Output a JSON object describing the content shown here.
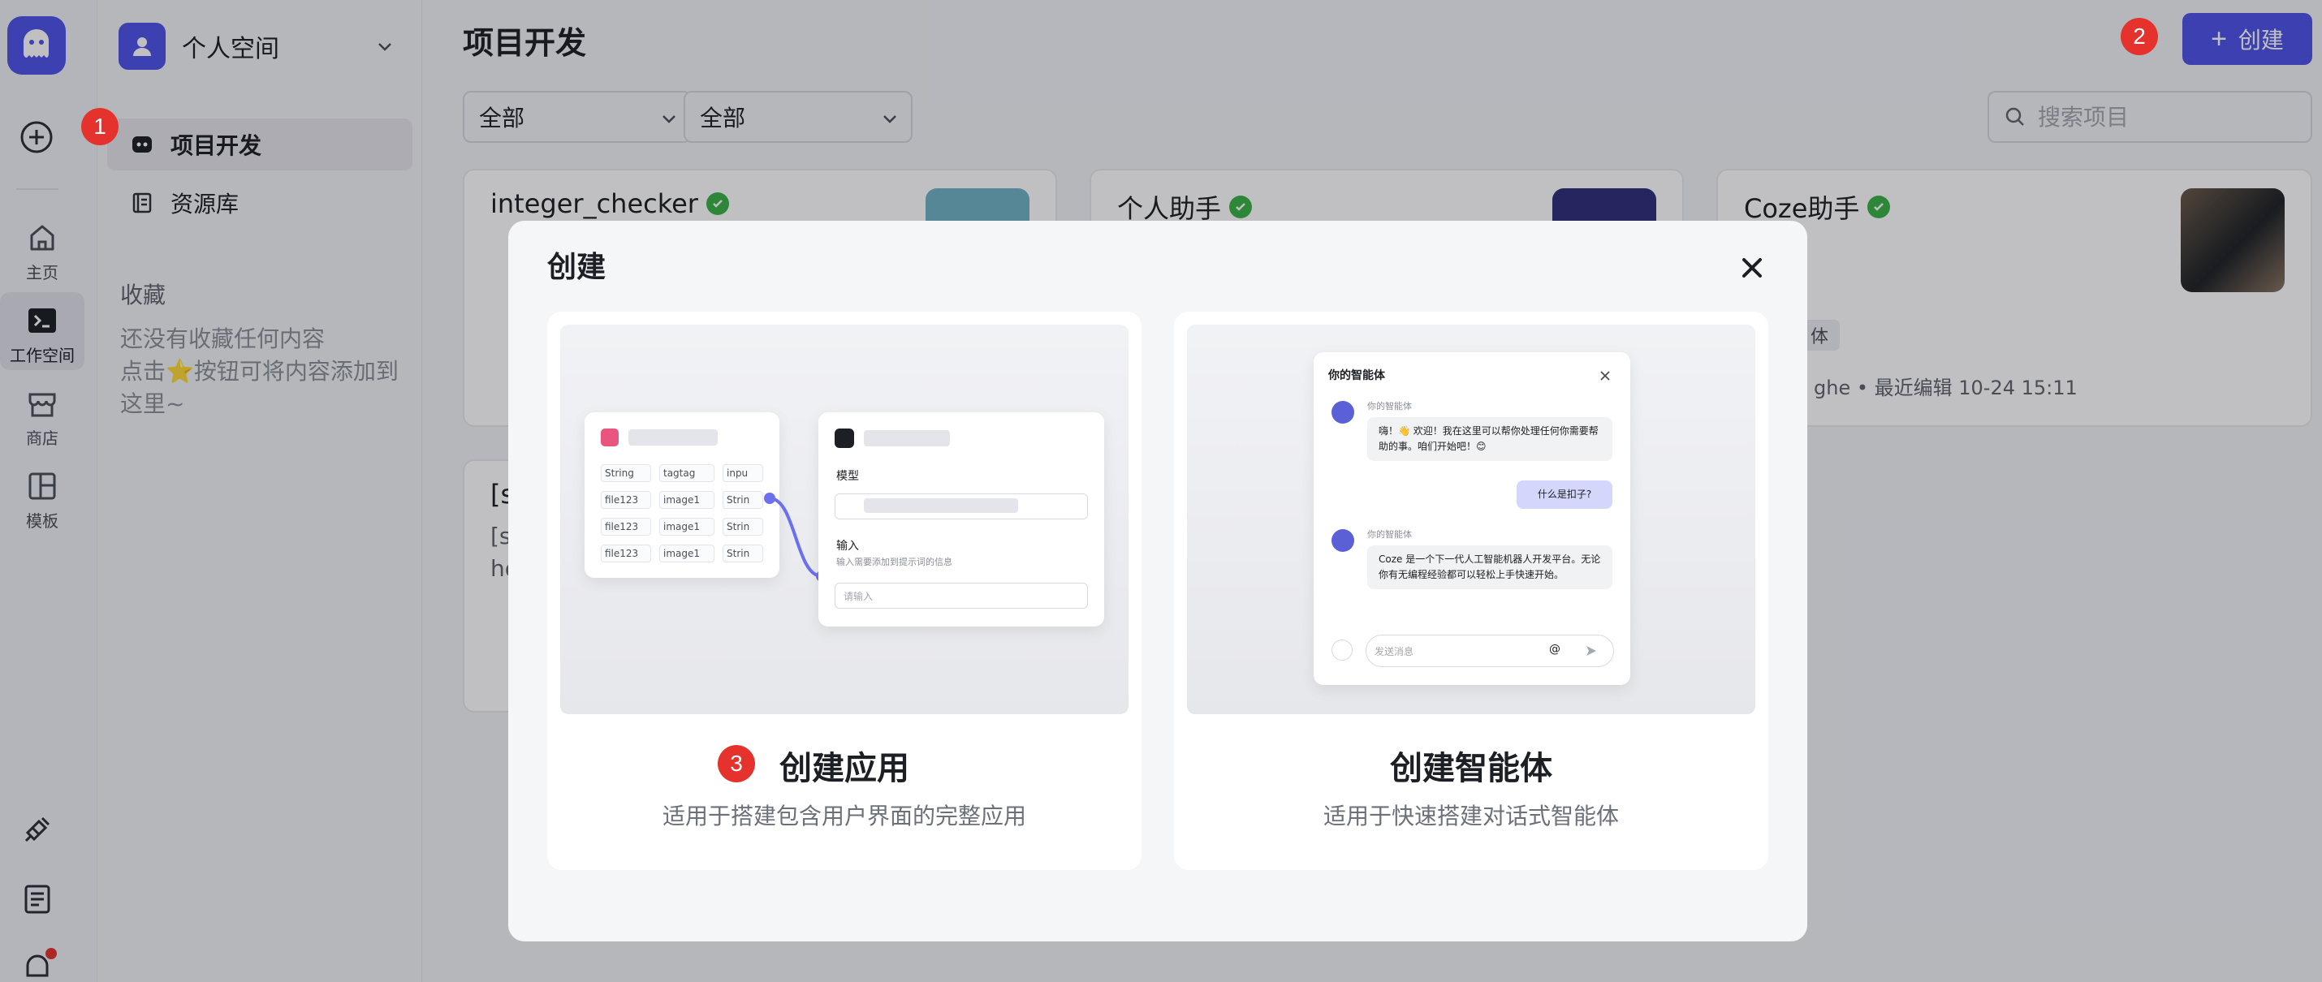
{
  "rail": {
    "items": [
      {
        "label": "主页"
      },
      {
        "label": "工作空间"
      },
      {
        "label": "商店"
      },
      {
        "label": "模板"
      }
    ]
  },
  "sidebar": {
    "space_name": "个人空间",
    "items": [
      {
        "label": "项目开发"
      },
      {
        "label": "资源库"
      }
    ],
    "favorites_title": "收藏",
    "favorites_empty": "还没有收藏任何内容\n点击⭐按钮可将内容添加到这里~"
  },
  "header": {
    "title": "项目开发",
    "create_label": "创建",
    "filters": [
      "全部",
      "全部"
    ],
    "search_placeholder": "搜索项目"
  },
  "cards": [
    {
      "title": "integer_checker",
      "thumb_color": "#6fb3c4"
    },
    {
      "title": "个人助手",
      "thumb_color": "#2e2f7a"
    },
    {
      "title": "Coze助手",
      "tag": "体",
      "meta": "ghe • 最近编辑 10-24 15:11"
    },
    {
      "title": "[s",
      "line2": "[s",
      "line3": "ho"
    }
  ],
  "modal": {
    "title": "创建",
    "options": [
      {
        "title": "创建应用",
        "desc": "适用于搭建包含用户界面的完整应用"
      },
      {
        "title": "创建智能体",
        "desc": "适用于快速搭建对话式智能体"
      }
    ],
    "app_preview": {
      "chips": [
        [
          "String",
          "tagtag",
          "inpu"
        ],
        [
          "file123",
          "image1",
          "Strin"
        ],
        [
          "file123",
          "image1",
          "Strin"
        ],
        [
          "file123",
          "image1",
          "Strin"
        ]
      ],
      "model_label": "模型",
      "input_label": "输入",
      "input_hint": "输入需要添加到提示词的信息",
      "input_placeholder": "请输入"
    },
    "agent_preview": {
      "title": "你的智能体",
      "sender": "你的智能体",
      "greeting": "嗨！👋 欢迎！我在这里可以帮你处理任何你需要帮助的事。咱们开始吧！😊",
      "user_msg": "什么是扣子?",
      "answer": "Coze 是一个下一代人工智能机器人开发平台。无论你有无编程经验都可以轻松上手快速开始。",
      "input_placeholder": "发送消息"
    }
  },
  "badges": [
    "1",
    "2",
    "3"
  ],
  "colors": {
    "accent": "#4d53e8",
    "badge": "#e5322d",
    "verified": "#3bb346"
  }
}
